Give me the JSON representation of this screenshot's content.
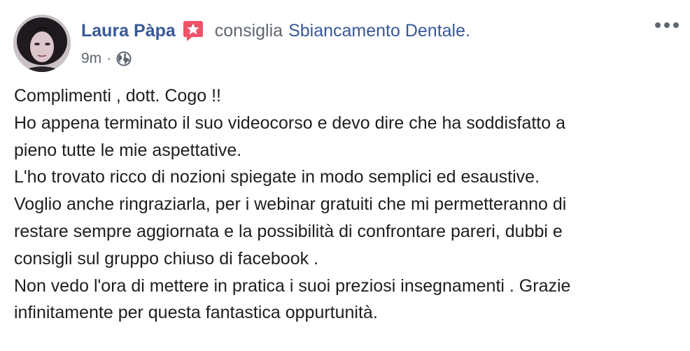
{
  "post": {
    "author": {
      "name": "Laura Pàpa"
    },
    "recommendation": {
      "verb": "consiglia",
      "page": "Sbiancamento Dentale."
    },
    "meta": {
      "time": "9m",
      "separator": "·",
      "audience_icon": "globe-icon"
    },
    "more_icon": "more-options-icon",
    "badge_icon": "recommendation-star-icon",
    "body_lines": [
      "Complimenti , dott. Cogo !!",
      "Ho appena terminato il suo videocorso e devo dire che ha soddisfatto a",
      "pieno tutte le mie aspettative.",
      "L'ho trovato ricco di nozioni spiegate in modo semplici ed esaustive.",
      "Voglio anche ringraziarla, per i webinar gratuiti che mi permetteranno di",
      "restare sempre aggiornata e la possibilità di confrontare pareri, dubbi e",
      "consigli sul gruppo chiuso di facebook .",
      "Non vedo l'ora di mettere in pratica i suoi preziosi insegnamenti . Grazie",
      "infinitamente per questa fantastica oppurtunità."
    ]
  },
  "colors": {
    "link": "#385898",
    "secondary_text": "#606770",
    "body_text": "#1c1e21",
    "badge": "#f25268",
    "background": "#ffffff"
  }
}
